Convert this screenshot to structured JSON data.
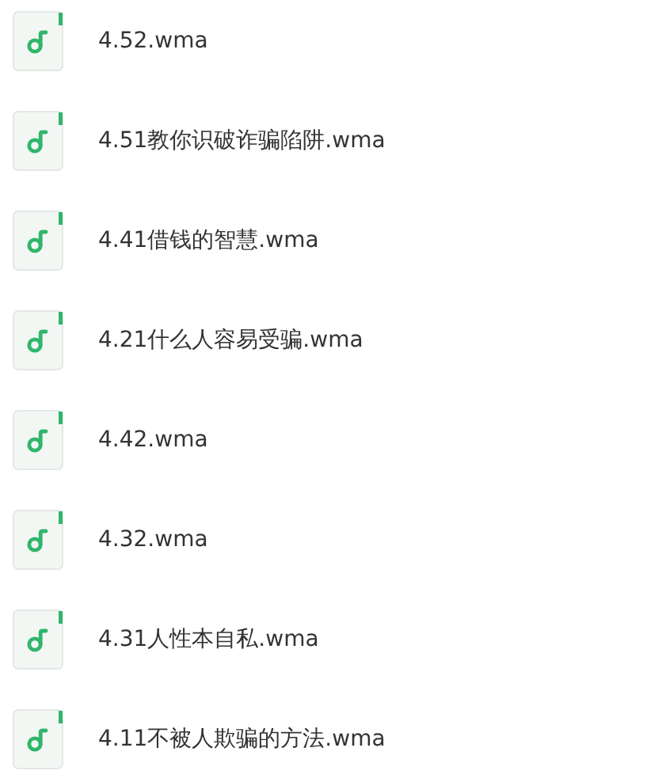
{
  "files": [
    {
      "name": "4.52.wma"
    },
    {
      "name": "4.51教你识破诈骗陷阱.wma"
    },
    {
      "name": "4.41借钱的智慧.wma"
    },
    {
      "name": "4.21什么人容易受骗.wma"
    },
    {
      "name": "4.42.wma"
    },
    {
      "name": "4.32.wma"
    },
    {
      "name": "4.31人性本自私.wma"
    },
    {
      "name": "4.11不被人欺骗的方法.wma"
    }
  ]
}
